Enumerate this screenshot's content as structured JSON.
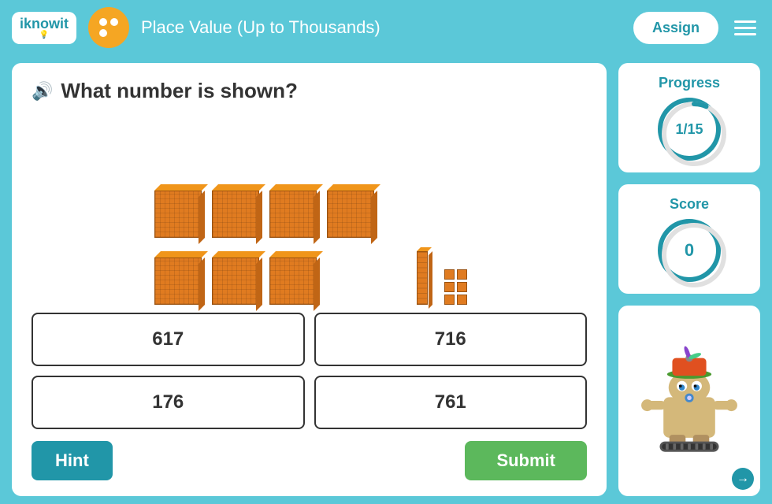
{
  "header": {
    "logo_text": "iknowit",
    "lesson_title": "Place Value (Up to Thousands)",
    "assign_label": "Assign",
    "menu_icon": "menu-icon"
  },
  "question": {
    "text": "What number is shown?",
    "speaker_label": "speaker-icon"
  },
  "answers": [
    {
      "value": "617",
      "id": "a1"
    },
    {
      "value": "716",
      "id": "a2"
    },
    {
      "value": "176",
      "id": "a3"
    },
    {
      "value": "761",
      "id": "a4"
    }
  ],
  "buttons": {
    "hint_label": "Hint",
    "submit_label": "Submit"
  },
  "progress": {
    "label": "Progress",
    "value": "1/15",
    "current": 1,
    "total": 15
  },
  "score": {
    "label": "Score",
    "value": "0"
  },
  "blocks": {
    "hundreds": 7,
    "tens": 1,
    "ones": 6,
    "description": "Base-10 blocks showing a number"
  }
}
